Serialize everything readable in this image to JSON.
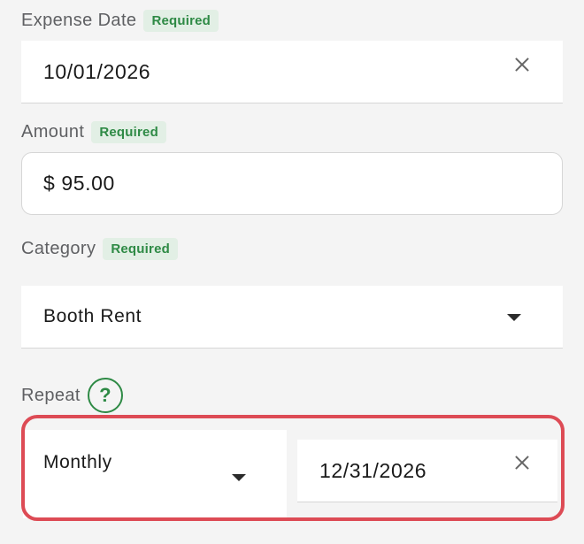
{
  "expense_date": {
    "label": "Expense Date",
    "badge": "Required",
    "value": "10/01/2026",
    "clear_icon": "close-icon"
  },
  "amount": {
    "label": "Amount",
    "badge": "Required",
    "value": "$ 95.00"
  },
  "category": {
    "label": "Category",
    "badge": "Required",
    "selected": "Booth Rent",
    "dropdown_icon": "caret-down-icon"
  },
  "repeat": {
    "label": "Repeat",
    "help_icon_text": "?",
    "frequency": "Monthly",
    "end_date": "12/31/2026",
    "clear_icon": "close-icon"
  },
  "colors": {
    "accent_green": "#2e8a45",
    "badge_bg": "#e2efe5",
    "highlight_red": "#dd4b55",
    "page_bg": "#f4f4f4"
  }
}
